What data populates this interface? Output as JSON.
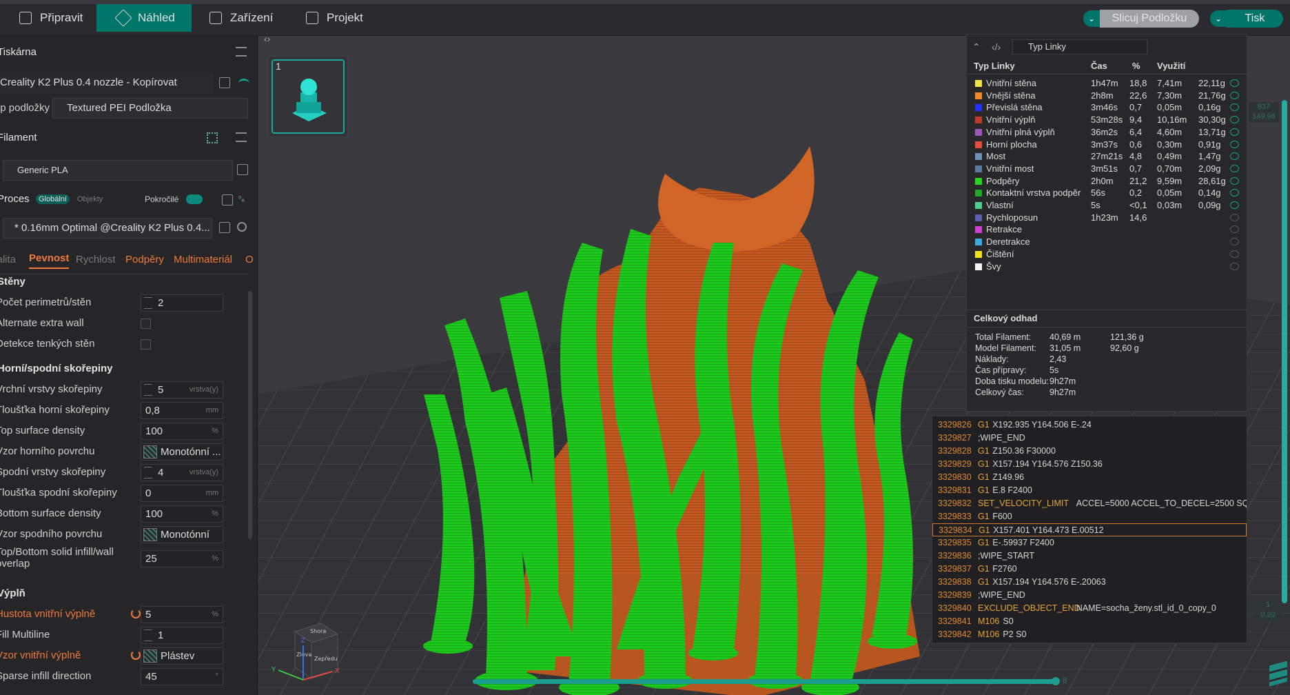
{
  "tabs": {
    "prepare": "Připravit",
    "preview": "Náhled",
    "device": "Zařízení",
    "project": "Projekt"
  },
  "actions": {
    "slice": "Slicuj Podložku",
    "print": "Tisk"
  },
  "printer": {
    "section": "Tiskárna",
    "name": "Creality K2 Plus 0.4 nozzle - Kopírovat",
    "plate_label": "Typ podložky",
    "plate_value": "Textured PEI Podložka"
  },
  "filament": {
    "section": "Filament",
    "value": "Generic PLA"
  },
  "process": {
    "section": "Proces",
    "global": "Globální",
    "objects": "Objekty",
    "advanced": "Pokročilé",
    "preset": "* 0.16mm Optimal @Creality K2 Plus 0.4..."
  },
  "subtabs": [
    "Kvalita",
    "Pevnost",
    "Rychlost",
    "Podpěry",
    "Multimateriál",
    "O"
  ],
  "settings": {
    "walls_group": "Stěny",
    "perimeters_label": "Počet perimetrů/stěn",
    "perimeters_value": "2",
    "alt_wall_label": "Alternate extra wall",
    "thin_walls_label": "Detekce tenkých stěn",
    "shells_group": "Horní/spodní skořepiny",
    "top_layers_label": "Vrchní vrstvy skořepiny",
    "top_layers_value": "5",
    "top_layers_unit": "vrstva(y)",
    "top_thick_label": "Tloušťka horní skořepiny",
    "top_thick_value": "0,8",
    "mm": "mm",
    "top_density_label": "Top surface density",
    "top_density_value": "100",
    "pct": "%",
    "top_pattern_label": "Vzor horního povrchu",
    "top_pattern_value": "Monotónní ...",
    "bottom_layers_label": "Spodní vrstvy skořepiny",
    "bottom_layers_value": "4",
    "bottom_layers_unit": "vrstva(y)",
    "bottom_thick_label": "Tloušťka spodní skořepiny",
    "bottom_thick_value": "0",
    "bottom_density_label": "Bottom surface density",
    "bottom_density_value": "100",
    "bottom_pattern_label": "Vzor spodního povrchu",
    "bottom_pattern_value": "Monotónní",
    "overlap_label_1": "Top/Bottom solid infill/wall",
    "overlap_label_2": "overlap",
    "overlap_value": "25",
    "infill_group": "Výplň",
    "infill_density_label": "Hustota vnitřní výplně",
    "infill_density_value": "5",
    "fill_multiline_label": "Fill Multiline",
    "fill_multiline_value": "1",
    "infill_pattern_label": "Vzor vnitřní výplně",
    "infill_pattern_value": "Plástev",
    "sparse_dir_label": "Sparse infill direction",
    "sparse_dir_value": "45",
    "deg": "°"
  },
  "plate": {
    "number": "1"
  },
  "legend": {
    "type_select": "Typ Linky",
    "headers": [
      "Typ Linky",
      "Čas",
      "%",
      "Využití"
    ],
    "rows": [
      {
        "name": "Vnitřní stěna",
        "time": "1h47m",
        "pct": "18,8",
        "len": "7,41m",
        "g": "22,11g",
        "color": "#f2e34a",
        "visible": true
      },
      {
        "name": "Vnější stěna",
        "time": "2h8m",
        "pct": "22,6",
        "len": "7,30m",
        "g": "21,76g",
        "color": "#f08a2a",
        "visible": true
      },
      {
        "name": "Převislá stěna",
        "time": "3m46s",
        "pct": "0,7",
        "len": "0,05m",
        "g": "0,16g",
        "color": "#2030ff",
        "visible": true
      },
      {
        "name": "Vnitřní výplň",
        "time": "53m28s",
        "pct": "9,4",
        "len": "10,16m",
        "g": "30,30g",
        "color": "#c0392b",
        "visible": true
      },
      {
        "name": "Vnitřní plná výplň",
        "time": "36m2s",
        "pct": "6,4",
        "len": "4,60m",
        "g": "13,71g",
        "color": "#9b59b6",
        "visible": true
      },
      {
        "name": "Horní plocha",
        "time": "3m37s",
        "pct": "0,6",
        "len": "0,30m",
        "g": "0,91g",
        "color": "#e74c3c",
        "visible": true
      },
      {
        "name": "Most",
        "time": "27m21s",
        "pct": "4,8",
        "len": "0,49m",
        "g": "1,47g",
        "color": "#6d8fb8",
        "visible": true
      },
      {
        "name": "Vnitřní most",
        "time": "3m51s",
        "pct": "0,7",
        "len": "0,70m",
        "g": "2,09g",
        "color": "#5a7aa0",
        "visible": true
      },
      {
        "name": "Podpěry",
        "time": "2h0m",
        "pct": "21,2",
        "len": "9,59m",
        "g": "28,61g",
        "color": "#27d61f",
        "visible": true
      },
      {
        "name": "Kontaktní vrstva podpěr",
        "time": "56s",
        "pct": "0,2",
        "len": "0,05m",
        "g": "0,14g",
        "color": "#1fa82a",
        "visible": true
      },
      {
        "name": "Vlastní",
        "time": "5s",
        "pct": "<0,1",
        "len": "0,03m",
        "g": "0,09g",
        "color": "#4ecf8e",
        "visible": true
      },
      {
        "name": "Rychloposun",
        "time": "1h23m",
        "pct": "14,6",
        "len": "",
        "g": "",
        "color": "#5b62b0",
        "visible": false
      },
      {
        "name": "Retrakce",
        "time": "",
        "pct": "",
        "len": "",
        "g": "",
        "color": "#d040d0",
        "visible": false
      },
      {
        "name": "Deretrakce",
        "time": "",
        "pct": "",
        "len": "",
        "g": "",
        "color": "#3da9e0",
        "visible": false
      },
      {
        "name": "Čištění",
        "time": "",
        "pct": "",
        "len": "",
        "g": "",
        "color": "#f2e31a",
        "visible": false
      },
      {
        "name": "Švy",
        "time": "",
        "pct": "",
        "len": "",
        "g": "",
        "color": "#f5f5f5",
        "visible": false
      }
    ],
    "estimate_title": "Celkový odhad",
    "estimate": [
      {
        "k": "Total Filament:",
        "v1": "40,69 m",
        "v2": "121,36 g"
      },
      {
        "k": "Model Filament:",
        "v1": "31,05 m",
        "v2": "92,60 g"
      },
      {
        "k": "Náklady:",
        "v1": "2,43",
        "v2": ""
      },
      {
        "k": "Čas přípravy:",
        "v1": "5s",
        "v2": ""
      },
      {
        "k": "Doba tisku modelu:",
        "v1": "9h27m",
        "v2": ""
      },
      {
        "k": "Celkový čas:",
        "v1": "9h27m",
        "v2": ""
      }
    ]
  },
  "gcode": [
    {
      "n": "3329826",
      "c": "G1",
      "a": "X192.935 Y164.506 E-.24"
    },
    {
      "n": "3329827",
      "c": "",
      "a": ";WIPE_END"
    },
    {
      "n": "3329828",
      "c": "G1",
      "a": "Z150.36 F30000"
    },
    {
      "n": "3329829",
      "c": "G1",
      "a": "X157.194 Y164.576 Z150.36"
    },
    {
      "n": "3329830",
      "c": "G1",
      "a": "Z149.96"
    },
    {
      "n": "3329831",
      "c": "G1",
      "a": "E.8 F2400"
    },
    {
      "n": "3329832",
      "c": "SET_VELOCITY_LIMIT",
      "a": "ACCEL=5000 ACCEL_TO_DECEL=2500 SQ..."
    },
    {
      "n": "3329833",
      "c": "G1",
      "a": "F600"
    },
    {
      "n": "3329834",
      "c": "G1",
      "a": "X157.401 Y164.473 E.00512",
      "hl": true
    },
    {
      "n": "3329835",
      "c": "G1",
      "a": "E-.59937 F2400"
    },
    {
      "n": "3329836",
      "c": "",
      "a": ";WIPE_START"
    },
    {
      "n": "3329837",
      "c": "G1",
      "a": "F2760"
    },
    {
      "n": "3329838",
      "c": "G1",
      "a": "X157.194 Y164.576 E-.20063"
    },
    {
      "n": "3329839",
      "c": "",
      "a": ";WIPE_END"
    },
    {
      "n": "3329840",
      "c": "EXCLUDE_OBJECT_END",
      "a": "NAME=socha_ženy.stl_id_0_copy_0"
    },
    {
      "n": "3329841",
      "c": "M106",
      "a": "S0"
    },
    {
      "n": "3329842",
      "c": "M106",
      "a": "P2 S0"
    }
  ],
  "sliders": {
    "layer_top": "937",
    "height_top": "149,96",
    "layer_bottom": "1",
    "height_bottom": "0,20",
    "move_label": "8"
  },
  "axis": {
    "top": "Shora",
    "left": "Zleva",
    "front": "Zepředu",
    "x": "X",
    "y": "Y",
    "z": "Z"
  }
}
